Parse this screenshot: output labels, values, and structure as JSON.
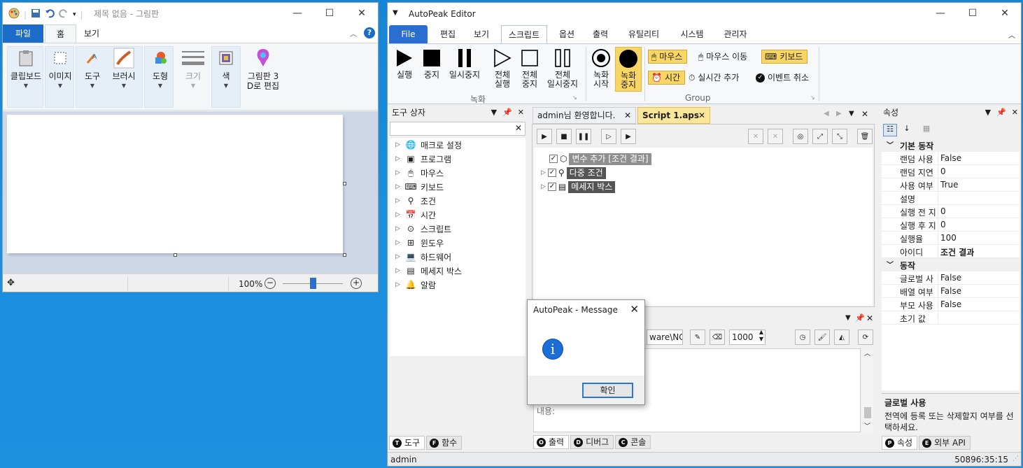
{
  "paint": {
    "title": "제목 없음 - 그림판",
    "tabs": {
      "file": "파일",
      "home": "홈",
      "view": "보기"
    },
    "ribbon": {
      "clipboard": "클립보드",
      "image": "이미지",
      "tools": "도구",
      "brushes": "브러시",
      "shapes": "도형",
      "size": "크기",
      "color": "색",
      "paint3d_line1": "그림판 3",
      "paint3d_line2": "D로 편집"
    },
    "status": {
      "zoom": "100%"
    }
  },
  "autopeak": {
    "title": "AutoPeak Editor",
    "menu": {
      "file": "File",
      "edit": "편집",
      "view": "보기",
      "script": "스크립트",
      "options": "옵션",
      "output": "출력",
      "utility": "유틸리티",
      "system": "시스템",
      "admin": "관리자"
    },
    "ribbon": {
      "run": "실행",
      "stop": "중지",
      "pause": "일시중지",
      "all": "전체",
      "run_all": "실행",
      "stop_all": "중지",
      "pause_all": "일시중지",
      "rec": "녹화",
      "rec_start": "시작",
      "rec_stop": "중지",
      "group_record": "녹화",
      "mouse": "마우스",
      "mouse_move": "마우스 이동",
      "keyboard": "키보드",
      "time": "시간",
      "add_realtime": "실시간 추가",
      "cancel_event": "이벤트 취소",
      "group_group": "Group"
    },
    "toolbox": {
      "title": "도구 상자",
      "items": [
        "매크로 설정",
        "프로그램",
        "마우스",
        "키보드",
        "조건",
        "시간",
        "스크립트",
        "윈도우",
        "하드웨어",
        "메세지 박스",
        "알람"
      ],
      "tab_tools": "도구",
      "tab_functions": "함수"
    },
    "doc": {
      "tab_welcome": "admin님 환영합니다.",
      "tab_script": "Script 1.aps",
      "nodes": [
        "변수 추가 [조건 결과]",
        "다중 조건",
        "메세지 박스"
      ]
    },
    "output": {
      "path": "ware\\NG",
      "interval": "1000",
      "tab_output": "출력",
      "tab_debug": "디버그",
      "tab_console": "콘솔",
      "log_fragment": "내용:"
    },
    "properties": {
      "title": "속성",
      "cat_basic": "기본 동작",
      "rows_basic": [
        {
          "k": "랜덤 사용",
          "v": "False"
        },
        {
          "k": "랜덤 지연",
          "v": "0"
        },
        {
          "k": "사용 여부",
          "v": "True"
        },
        {
          "k": "설명",
          "v": ""
        },
        {
          "k": "실행 전 지",
          "v": "0"
        },
        {
          "k": "실행 후 지",
          "v": "0"
        },
        {
          "k": "실행율",
          "v": "100"
        },
        {
          "k": "아이디",
          "v": "조건 결과"
        }
      ],
      "cat_action": "동작",
      "rows_action": [
        {
          "k": "글로벌 사",
          "v": "False"
        },
        {
          "k": "배열 여부",
          "v": "False"
        },
        {
          "k": "부모 사용",
          "v": "False"
        },
        {
          "k": "초기 값",
          "v": ""
        }
      ],
      "desc_title": "글로벌 사용",
      "desc_text": "전역에 등록 또는 삭제할지 여부를 선택하세요.",
      "tab_props": "속성",
      "tab_api": "외부 API"
    },
    "status": {
      "user": "admin",
      "time": "50896:35:15"
    }
  },
  "message": {
    "title": "AutoPeak - Message",
    "ok": "확인"
  }
}
